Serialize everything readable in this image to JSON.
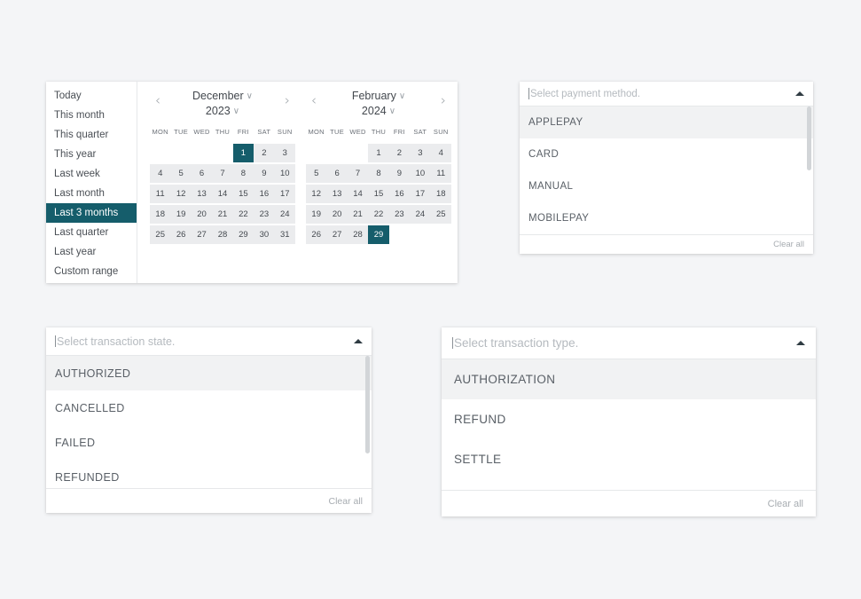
{
  "date_range_picker": {
    "presets": [
      {
        "label": "Today",
        "selected": false
      },
      {
        "label": "This month",
        "selected": false
      },
      {
        "label": "This quarter",
        "selected": false
      },
      {
        "label": "This year",
        "selected": false
      },
      {
        "label": "Last week",
        "selected": false
      },
      {
        "label": "Last month",
        "selected": false
      },
      {
        "label": "Last 3 months",
        "selected": true
      },
      {
        "label": "Last quarter",
        "selected": false
      },
      {
        "label": "Last year",
        "selected": false
      },
      {
        "label": "Custom range",
        "selected": false
      }
    ],
    "prev_arrow": "‹",
    "next_arrow": "›",
    "caret": "∨",
    "day_headers": [
      "MON",
      "TUE",
      "WED",
      "THU",
      "FRI",
      "SAT",
      "SUN"
    ],
    "calendars": [
      {
        "month": "December",
        "year": "2023",
        "weeks": [
          [
            "",
            "",
            "",
            "",
            "1",
            "2",
            "3"
          ],
          [
            "4",
            "5",
            "6",
            "7",
            "8",
            "9",
            "10"
          ],
          [
            "11",
            "12",
            "13",
            "14",
            "15",
            "16",
            "17"
          ],
          [
            "18",
            "19",
            "20",
            "21",
            "22",
            "23",
            "24"
          ],
          [
            "25",
            "26",
            "27",
            "28",
            "29",
            "30",
            "31"
          ]
        ],
        "selected_day": "1"
      },
      {
        "month": "February",
        "year": "2024",
        "weeks": [
          [
            "",
            "",
            "",
            "1",
            "2",
            "3",
            "4"
          ],
          [
            "5",
            "6",
            "7",
            "8",
            "9",
            "10",
            "11"
          ],
          [
            "12",
            "13",
            "14",
            "15",
            "16",
            "17",
            "18"
          ],
          [
            "19",
            "20",
            "21",
            "22",
            "23",
            "24",
            "25"
          ],
          [
            "26",
            "27",
            "28",
            "29",
            "",
            "",
            ""
          ]
        ],
        "selected_day": "29"
      }
    ]
  },
  "payment_method_select": {
    "placeholder": "Select payment method.",
    "options": [
      "APPLEPAY",
      "CARD",
      "MANUAL",
      "MOBILEPAY"
    ],
    "highlighted_index": 0,
    "clear_all_label": "Clear all"
  },
  "transaction_state_select": {
    "placeholder": "Select transaction state.",
    "options": [
      "AUTHORIZED",
      "CANCELLED",
      "FAILED",
      "REFUNDED"
    ],
    "highlighted_index": 0,
    "clear_all_label": "Clear all"
  },
  "transaction_type_select": {
    "placeholder": "Select transaction type.",
    "options": [
      "AUTHORIZATION",
      "REFUND",
      "SETTLE"
    ],
    "highlighted_index": 0,
    "clear_all_label": "Clear all"
  },
  "colors": {
    "accent_teal": "#155d6b",
    "page_background": "#f4f5f7",
    "day_cell": "#ebecee",
    "highlight_row": "#f1f2f3"
  }
}
